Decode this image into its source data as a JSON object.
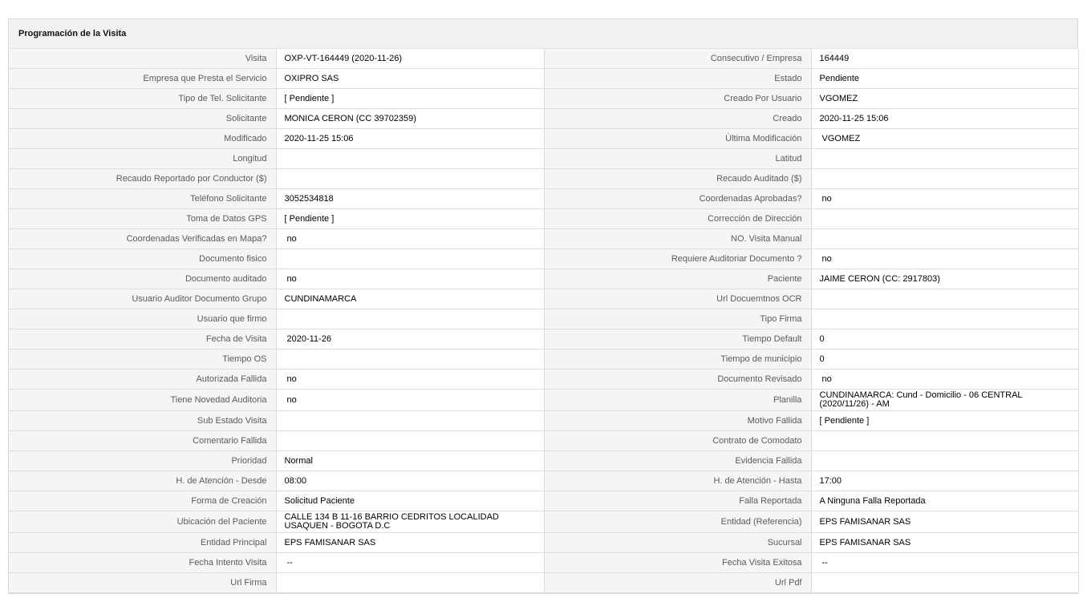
{
  "section": {
    "title": "Programación de la Visita"
  },
  "rows": [
    {
      "left": {
        "label": "Visita",
        "value": "OXP-VT-164449 (2020-11-26)"
      },
      "right": {
        "label": "Consecutivo / Empresa",
        "value": "164449"
      }
    },
    {
      "left": {
        "label": "Empresa que Presta el Servicio",
        "value": "OXIPRO SAS"
      },
      "right": {
        "label": "Estado",
        "value": "Pendiente"
      }
    },
    {
      "left": {
        "label": "Tipo de Tel. Solicitante",
        "value": "[ Pendiente ]"
      },
      "right": {
        "label": "Creado Por Usuario",
        "value": "VGOMEZ"
      }
    },
    {
      "left": {
        "label": "Solicitante",
        "value": "MONICA CERON (CC 39702359)"
      },
      "right": {
        "label": "Creado",
        "value": "2020-11-25 15:06"
      }
    },
    {
      "left": {
        "label": "Modificado",
        "value": "2020-11-25 15:06"
      },
      "right": {
        "label": "Última Modificación",
        "value": "VGOMEZ"
      }
    },
    {
      "left": {
        "label": "Longitud",
        "value": ""
      },
      "right": {
        "label": "Latitud",
        "value": ""
      }
    },
    {
      "left": {
        "label": "Recaudo Reportado por Conductor ($)",
        "value": ""
      },
      "right": {
        "label": "Recaudo Auditado ($)",
        "value": ""
      }
    },
    {
      "left": {
        "label": "Teléfono Solicitante",
        "value": "3052534818"
      },
      "right": {
        "label": "Coordenadas Aprobadas?",
        "value": "no"
      }
    },
    {
      "left": {
        "label": "Toma de Datos GPS",
        "value": "[ Pendiente ]"
      },
      "right": {
        "label": "Corrección de Dirección",
        "value": ""
      }
    },
    {
      "left": {
        "label": "Coordenadas Verificadas en Mapa?",
        "value": "no"
      },
      "right": {
        "label": "NO. Visita Manual",
        "value": ""
      }
    },
    {
      "left": {
        "label": "Documento fisico",
        "value": ""
      },
      "right": {
        "label": "Requiere Auditoriar Documento ?",
        "value": "no"
      }
    },
    {
      "left": {
        "label": "Documento auditado",
        "value": "no"
      },
      "right": {
        "label": "Paciente",
        "value": "JAIME CERON (CC: 2917803)"
      }
    },
    {
      "left": {
        "label": "Usuario Auditor Documento Grupo",
        "value": "CUNDINAMARCA"
      },
      "right": {
        "label": "Url Docuemtnos OCR",
        "value": ""
      }
    },
    {
      "left": {
        "label": "Usuario que firmo",
        "value": ""
      },
      "right": {
        "label": "Tipo Firma",
        "value": ""
      }
    },
    {
      "left": {
        "label": "Fecha de Visita",
        "value": "2020-11-26"
      },
      "right": {
        "label": "Tiempo Default",
        "value": "0"
      }
    },
    {
      "left": {
        "label": "Tiempo OS",
        "value": ""
      },
      "right": {
        "label": "Tiempo de municipio",
        "value": "0"
      }
    },
    {
      "left": {
        "label": "Autorizada Fallida",
        "value": "no"
      },
      "right": {
        "label": "Documento Revisado",
        "value": "no"
      }
    },
    {
      "left": {
        "label": "Tiene Novedad Auditoria",
        "value": "no"
      },
      "right": {
        "label": "Planilla",
        "value": "CUNDINAMARCA: Cund - Domicilio - 06 CENTRAL (2020/11/26) - AM"
      }
    },
    {
      "left": {
        "label": "Sub Estado Visita",
        "value": ""
      },
      "right": {
        "label": "Motivo Fallida",
        "value": "[ Pendiente ]"
      }
    },
    {
      "left": {
        "label": "Comentario Fallida",
        "value": ""
      },
      "right": {
        "label": "Contrato de Comodato",
        "value": ""
      }
    },
    {
      "left": {
        "label": "Prioridad",
        "value": "Normal"
      },
      "right": {
        "label": "Evidencia Fallida",
        "value": ""
      }
    },
    {
      "left": {
        "label": "H. de Atención - Desde",
        "value": "08:00"
      },
      "right": {
        "label": "H. de Atención - Hasta",
        "value": "17:00"
      }
    },
    {
      "left": {
        "label": "Forma de Creación",
        "value": "Solicitud Paciente"
      },
      "right": {
        "label": "Falla Reportada",
        "value": "A Ninguna Falla Reportada"
      }
    },
    {
      "left": {
        "label": "Ubicación del Paciente",
        "value": "CALLE 134 B 11-16 BARRIO CEDRITOS LOCALIDAD USAQUEN - BOGOTA D.C"
      },
      "right": {
        "label": "Entidad (Referencia)",
        "value": "EPS FAMISANAR SAS"
      }
    },
    {
      "left": {
        "label": "Entidad Principal",
        "value": "EPS FAMISANAR SAS"
      },
      "right": {
        "label": "Sucursal",
        "value": "EPS FAMISANAR SAS"
      }
    },
    {
      "left": {
        "label": "Fecha Intento Visita",
        "value": "--"
      },
      "right": {
        "label": "Fecha Visita Exitosa",
        "value": "--"
      }
    },
    {
      "left": {
        "label": "Url Firma",
        "value": ""
      },
      "right": {
        "label": "Url Pdf",
        "value": ""
      }
    }
  ]
}
